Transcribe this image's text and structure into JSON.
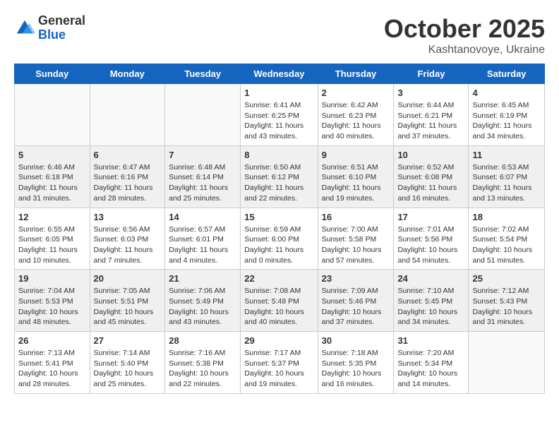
{
  "header": {
    "logo": {
      "general": "General",
      "blue": "Blue"
    },
    "title": "October 2025",
    "location": "Kashtanovoye, Ukraine"
  },
  "calendar": {
    "days_of_week": [
      "Sunday",
      "Monday",
      "Tuesday",
      "Wednesday",
      "Thursday",
      "Friday",
      "Saturday"
    ],
    "weeks": [
      {
        "shaded": false,
        "days": [
          {
            "empty": true
          },
          {
            "empty": true
          },
          {
            "empty": true
          },
          {
            "num": "1",
            "sunrise": "Sunrise: 6:41 AM",
            "sunset": "Sunset: 6:25 PM",
            "daylight": "Daylight: 11 hours and 43 minutes."
          },
          {
            "num": "2",
            "sunrise": "Sunrise: 6:42 AM",
            "sunset": "Sunset: 6:23 PM",
            "daylight": "Daylight: 11 hours and 40 minutes."
          },
          {
            "num": "3",
            "sunrise": "Sunrise: 6:44 AM",
            "sunset": "Sunset: 6:21 PM",
            "daylight": "Daylight: 11 hours and 37 minutes."
          },
          {
            "num": "4",
            "sunrise": "Sunrise: 6:45 AM",
            "sunset": "Sunset: 6:19 PM",
            "daylight": "Daylight: 11 hours and 34 minutes."
          }
        ]
      },
      {
        "shaded": true,
        "days": [
          {
            "num": "5",
            "sunrise": "Sunrise: 6:46 AM",
            "sunset": "Sunset: 6:18 PM",
            "daylight": "Daylight: 11 hours and 31 minutes."
          },
          {
            "num": "6",
            "sunrise": "Sunrise: 6:47 AM",
            "sunset": "Sunset: 6:16 PM",
            "daylight": "Daylight: 11 hours and 28 minutes."
          },
          {
            "num": "7",
            "sunrise": "Sunrise: 6:48 AM",
            "sunset": "Sunset: 6:14 PM",
            "daylight": "Daylight: 11 hours and 25 minutes."
          },
          {
            "num": "8",
            "sunrise": "Sunrise: 6:50 AM",
            "sunset": "Sunset: 6:12 PM",
            "daylight": "Daylight: 11 hours and 22 minutes."
          },
          {
            "num": "9",
            "sunrise": "Sunrise: 6:51 AM",
            "sunset": "Sunset: 6:10 PM",
            "daylight": "Daylight: 11 hours and 19 minutes."
          },
          {
            "num": "10",
            "sunrise": "Sunrise: 6:52 AM",
            "sunset": "Sunset: 6:08 PM",
            "daylight": "Daylight: 11 hours and 16 minutes."
          },
          {
            "num": "11",
            "sunrise": "Sunrise: 6:53 AM",
            "sunset": "Sunset: 6:07 PM",
            "daylight": "Daylight: 11 hours and 13 minutes."
          }
        ]
      },
      {
        "shaded": false,
        "days": [
          {
            "num": "12",
            "sunrise": "Sunrise: 6:55 AM",
            "sunset": "Sunset: 6:05 PM",
            "daylight": "Daylight: 11 hours and 10 minutes."
          },
          {
            "num": "13",
            "sunrise": "Sunrise: 6:56 AM",
            "sunset": "Sunset: 6:03 PM",
            "daylight": "Daylight: 11 hours and 7 minutes."
          },
          {
            "num": "14",
            "sunrise": "Sunrise: 6:57 AM",
            "sunset": "Sunset: 6:01 PM",
            "daylight": "Daylight: 11 hours and 4 minutes."
          },
          {
            "num": "15",
            "sunrise": "Sunrise: 6:59 AM",
            "sunset": "Sunset: 6:00 PM",
            "daylight": "Daylight: 11 hours and 0 minutes."
          },
          {
            "num": "16",
            "sunrise": "Sunrise: 7:00 AM",
            "sunset": "Sunset: 5:58 PM",
            "daylight": "Daylight: 10 hours and 57 minutes."
          },
          {
            "num": "17",
            "sunrise": "Sunrise: 7:01 AM",
            "sunset": "Sunset: 5:56 PM",
            "daylight": "Daylight: 10 hours and 54 minutes."
          },
          {
            "num": "18",
            "sunrise": "Sunrise: 7:02 AM",
            "sunset": "Sunset: 5:54 PM",
            "daylight": "Daylight: 10 hours and 51 minutes."
          }
        ]
      },
      {
        "shaded": true,
        "days": [
          {
            "num": "19",
            "sunrise": "Sunrise: 7:04 AM",
            "sunset": "Sunset: 5:53 PM",
            "daylight": "Daylight: 10 hours and 48 minutes."
          },
          {
            "num": "20",
            "sunrise": "Sunrise: 7:05 AM",
            "sunset": "Sunset: 5:51 PM",
            "daylight": "Daylight: 10 hours and 45 minutes."
          },
          {
            "num": "21",
            "sunrise": "Sunrise: 7:06 AM",
            "sunset": "Sunset: 5:49 PM",
            "daylight": "Daylight: 10 hours and 43 minutes."
          },
          {
            "num": "22",
            "sunrise": "Sunrise: 7:08 AM",
            "sunset": "Sunset: 5:48 PM",
            "daylight": "Daylight: 10 hours and 40 minutes."
          },
          {
            "num": "23",
            "sunrise": "Sunrise: 7:09 AM",
            "sunset": "Sunset: 5:46 PM",
            "daylight": "Daylight: 10 hours and 37 minutes."
          },
          {
            "num": "24",
            "sunrise": "Sunrise: 7:10 AM",
            "sunset": "Sunset: 5:45 PM",
            "daylight": "Daylight: 10 hours and 34 minutes."
          },
          {
            "num": "25",
            "sunrise": "Sunrise: 7:12 AM",
            "sunset": "Sunset: 5:43 PM",
            "daylight": "Daylight: 10 hours and 31 minutes."
          }
        ]
      },
      {
        "shaded": false,
        "days": [
          {
            "num": "26",
            "sunrise": "Sunrise: 7:13 AM",
            "sunset": "Sunset: 5:41 PM",
            "daylight": "Daylight: 10 hours and 28 minutes."
          },
          {
            "num": "27",
            "sunrise": "Sunrise: 7:14 AM",
            "sunset": "Sunset: 5:40 PM",
            "daylight": "Daylight: 10 hours and 25 minutes."
          },
          {
            "num": "28",
            "sunrise": "Sunrise: 7:16 AM",
            "sunset": "Sunset: 5:38 PM",
            "daylight": "Daylight: 10 hours and 22 minutes."
          },
          {
            "num": "29",
            "sunrise": "Sunrise: 7:17 AM",
            "sunset": "Sunset: 5:37 PM",
            "daylight": "Daylight: 10 hours and 19 minutes."
          },
          {
            "num": "30",
            "sunrise": "Sunrise: 7:18 AM",
            "sunset": "Sunset: 5:35 PM",
            "daylight": "Daylight: 10 hours and 16 minutes."
          },
          {
            "num": "31",
            "sunrise": "Sunrise: 7:20 AM",
            "sunset": "Sunset: 5:34 PM",
            "daylight": "Daylight: 10 hours and 14 minutes."
          },
          {
            "empty": true
          }
        ]
      }
    ]
  }
}
